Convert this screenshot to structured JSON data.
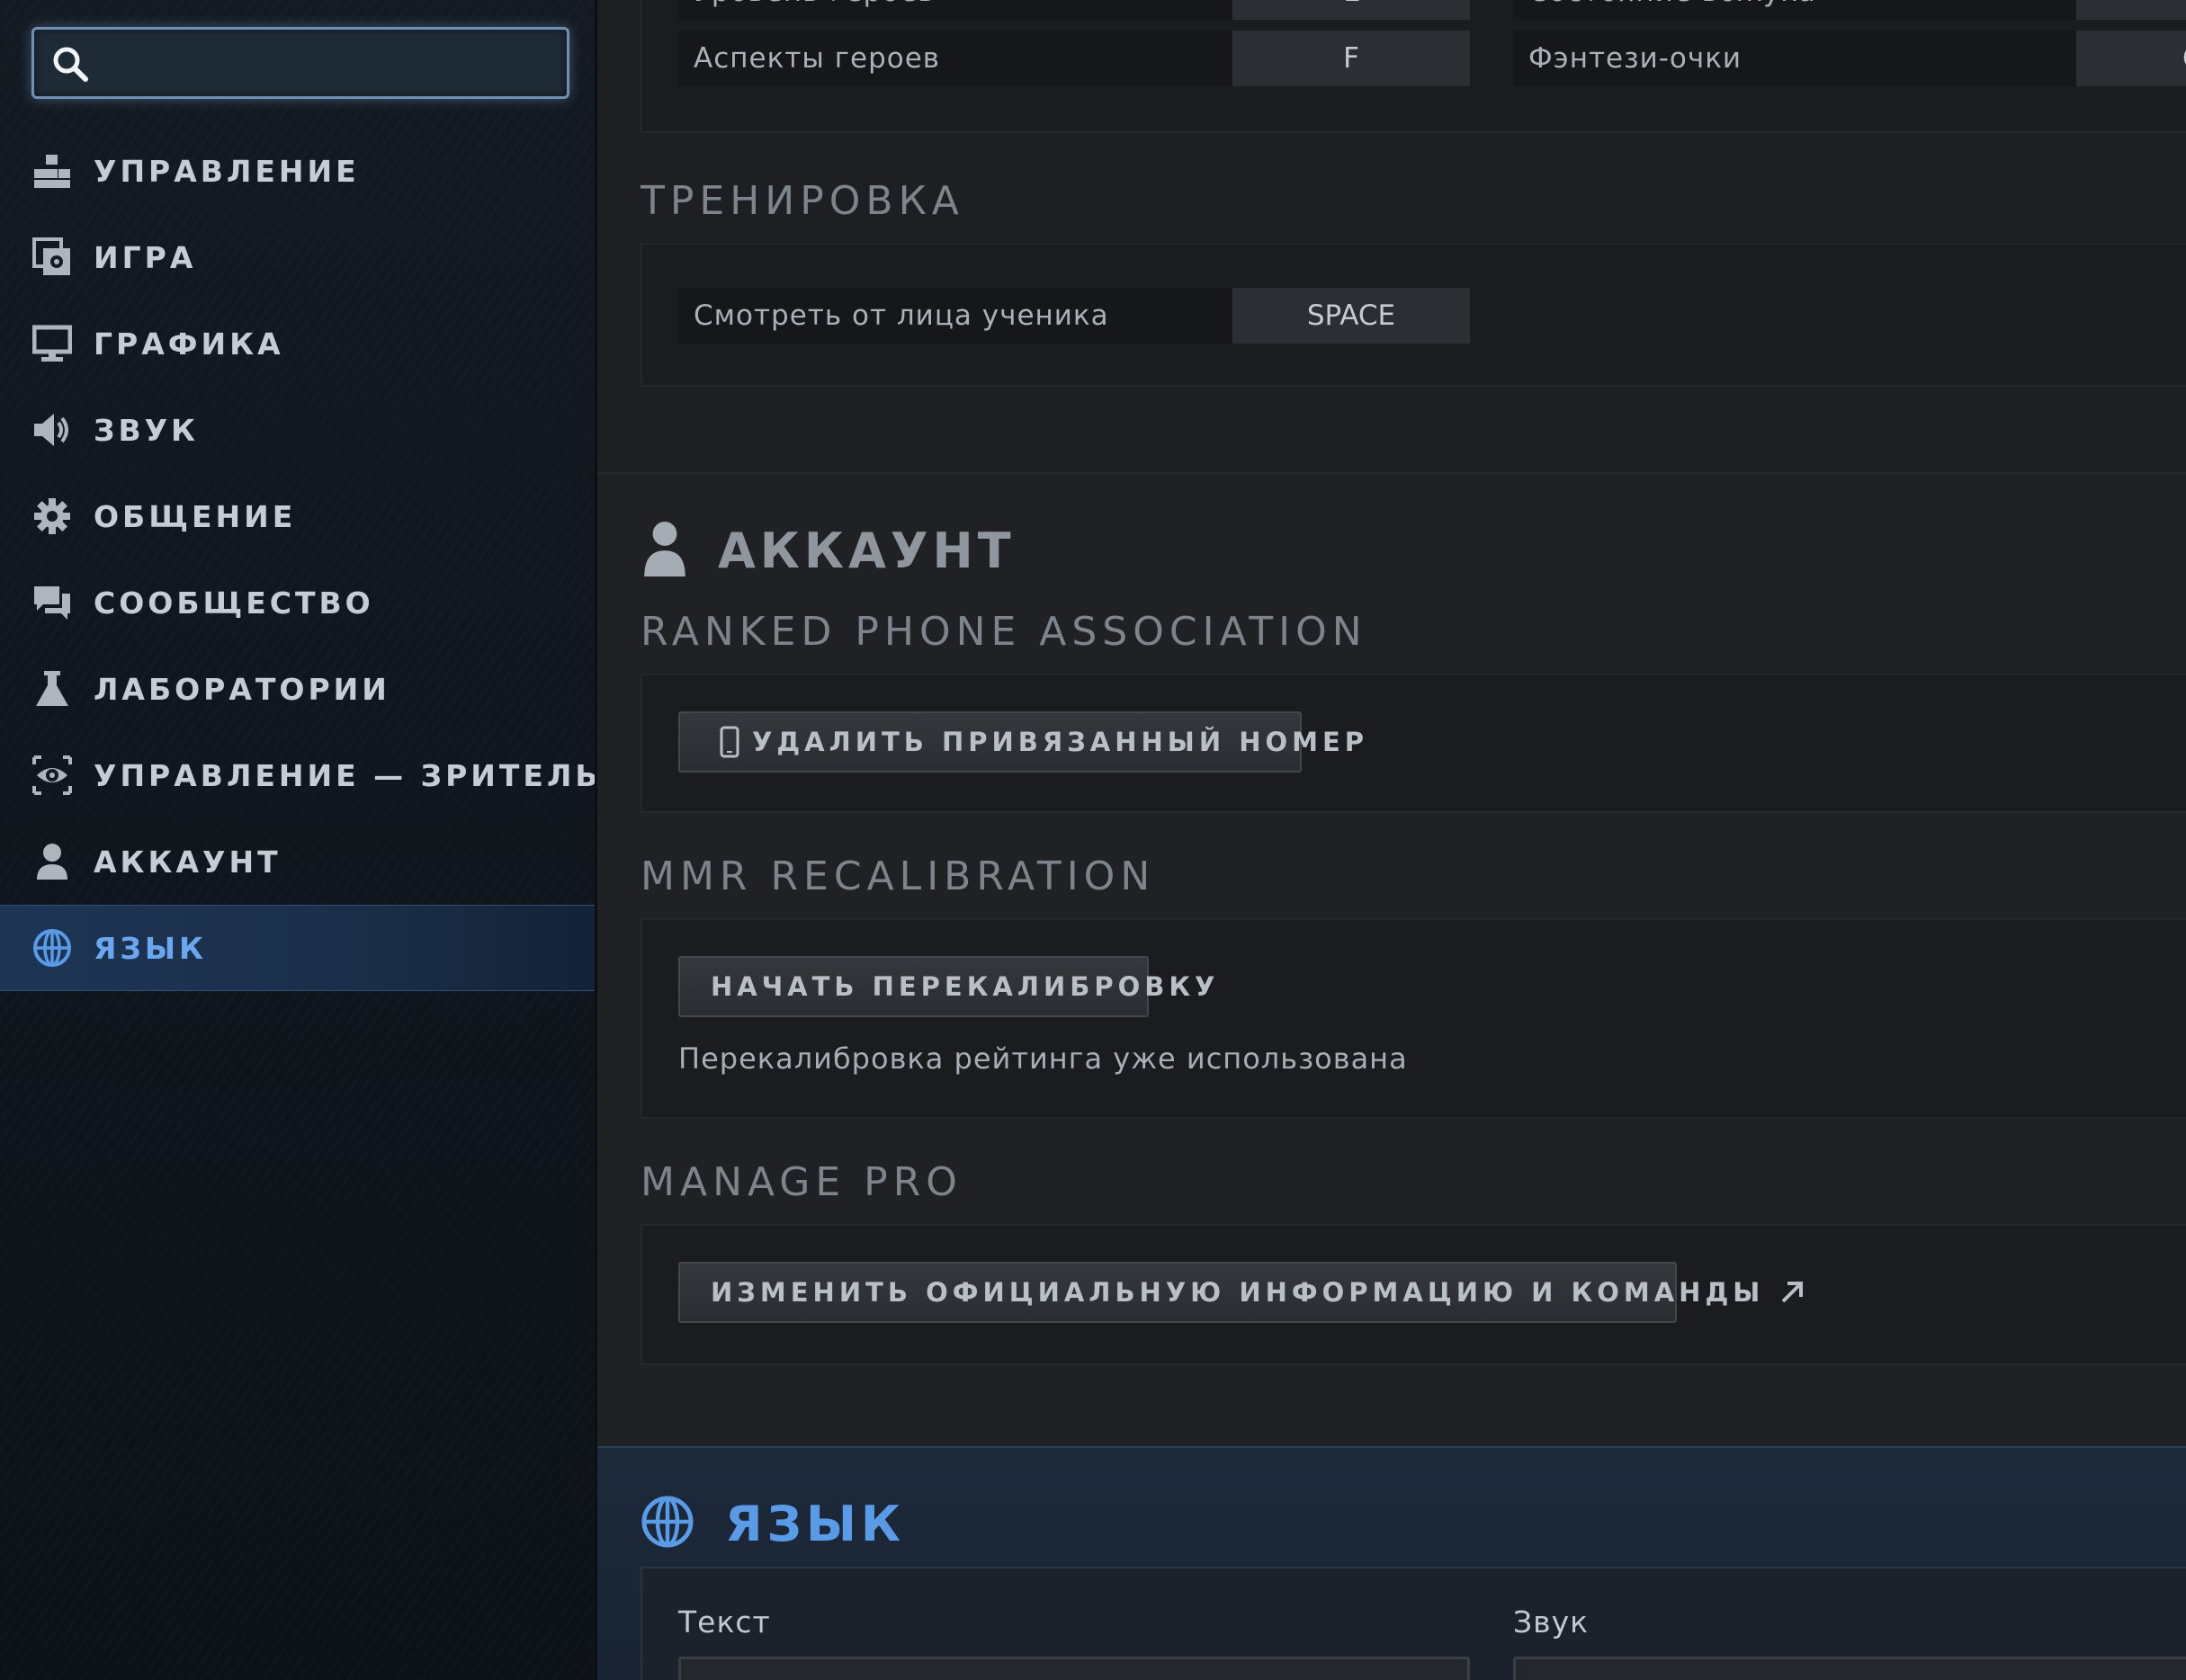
{
  "search": {
    "value": "",
    "placeholder": ""
  },
  "sidebar": {
    "items": [
      {
        "label": "УПРАВЛЕНИЕ",
        "icon": "controls-icon"
      },
      {
        "label": "ИГРА",
        "icon": "game-settings-icon"
      },
      {
        "label": "ГРАФИКА",
        "icon": "monitor-icon"
      },
      {
        "label": "ЗВУК",
        "icon": "speaker-icon"
      },
      {
        "label": "ОБЩЕНИЕ",
        "icon": "gear-icon"
      },
      {
        "label": "СООБЩЕСТВО",
        "icon": "chat-bubbles-icon"
      },
      {
        "label": "ЛАБОРАТОРИИ",
        "icon": "flask-icon"
      },
      {
        "label": "УПРАВЛЕНИЕ — ЗРИТЕЛЬ",
        "icon": "spectator-eye-icon"
      },
      {
        "label": "АККАУНТ",
        "icon": "user-icon"
      },
      {
        "label": "ЯЗЫК",
        "icon": "globe-icon",
        "active": true
      }
    ]
  },
  "hotkeys_top": {
    "row_partial_left_label": "Уровень героев",
    "row_partial_left_key": "L",
    "row_partial_right_label": "Состояние вожука",
    "row_left_label": "Аспекты героев",
    "row_left_key": "F",
    "row_right_label": "Фэнтези-очки",
    "row_right_key": "O"
  },
  "training": {
    "heading": "ТРЕНИРОВКА",
    "hotkey_label": "Смотреть от лица ученика",
    "hotkey_key": "SPACE"
  },
  "account": {
    "title": "АККАУНТ",
    "ranked_phone": {
      "heading": "RANKED PHONE ASSOCIATION",
      "button": "УДАЛИТЬ ПРИВЯЗАННЫЙ НОМЕР"
    },
    "mmr": {
      "heading": "MMR RECALIBRATION",
      "button": "НАЧАТЬ ПЕРЕКАЛИБРОВКУ",
      "note": "Перекалибровка рейтинга уже использована"
    },
    "manage_pro": {
      "heading": "MANAGE PRO",
      "button": "ИЗМЕНИТЬ ОФИЦИАЛЬНУЮ ИНФОРМАЦИЮ И КОМАНДЫ"
    }
  },
  "language": {
    "title": "ЯЗЫК",
    "text_label": "Текст",
    "sound_label": "Звук"
  },
  "colors": {
    "accent": "#5a9be8",
    "sidebar_bg": "#111820",
    "main_bg": "#1d1f22"
  }
}
